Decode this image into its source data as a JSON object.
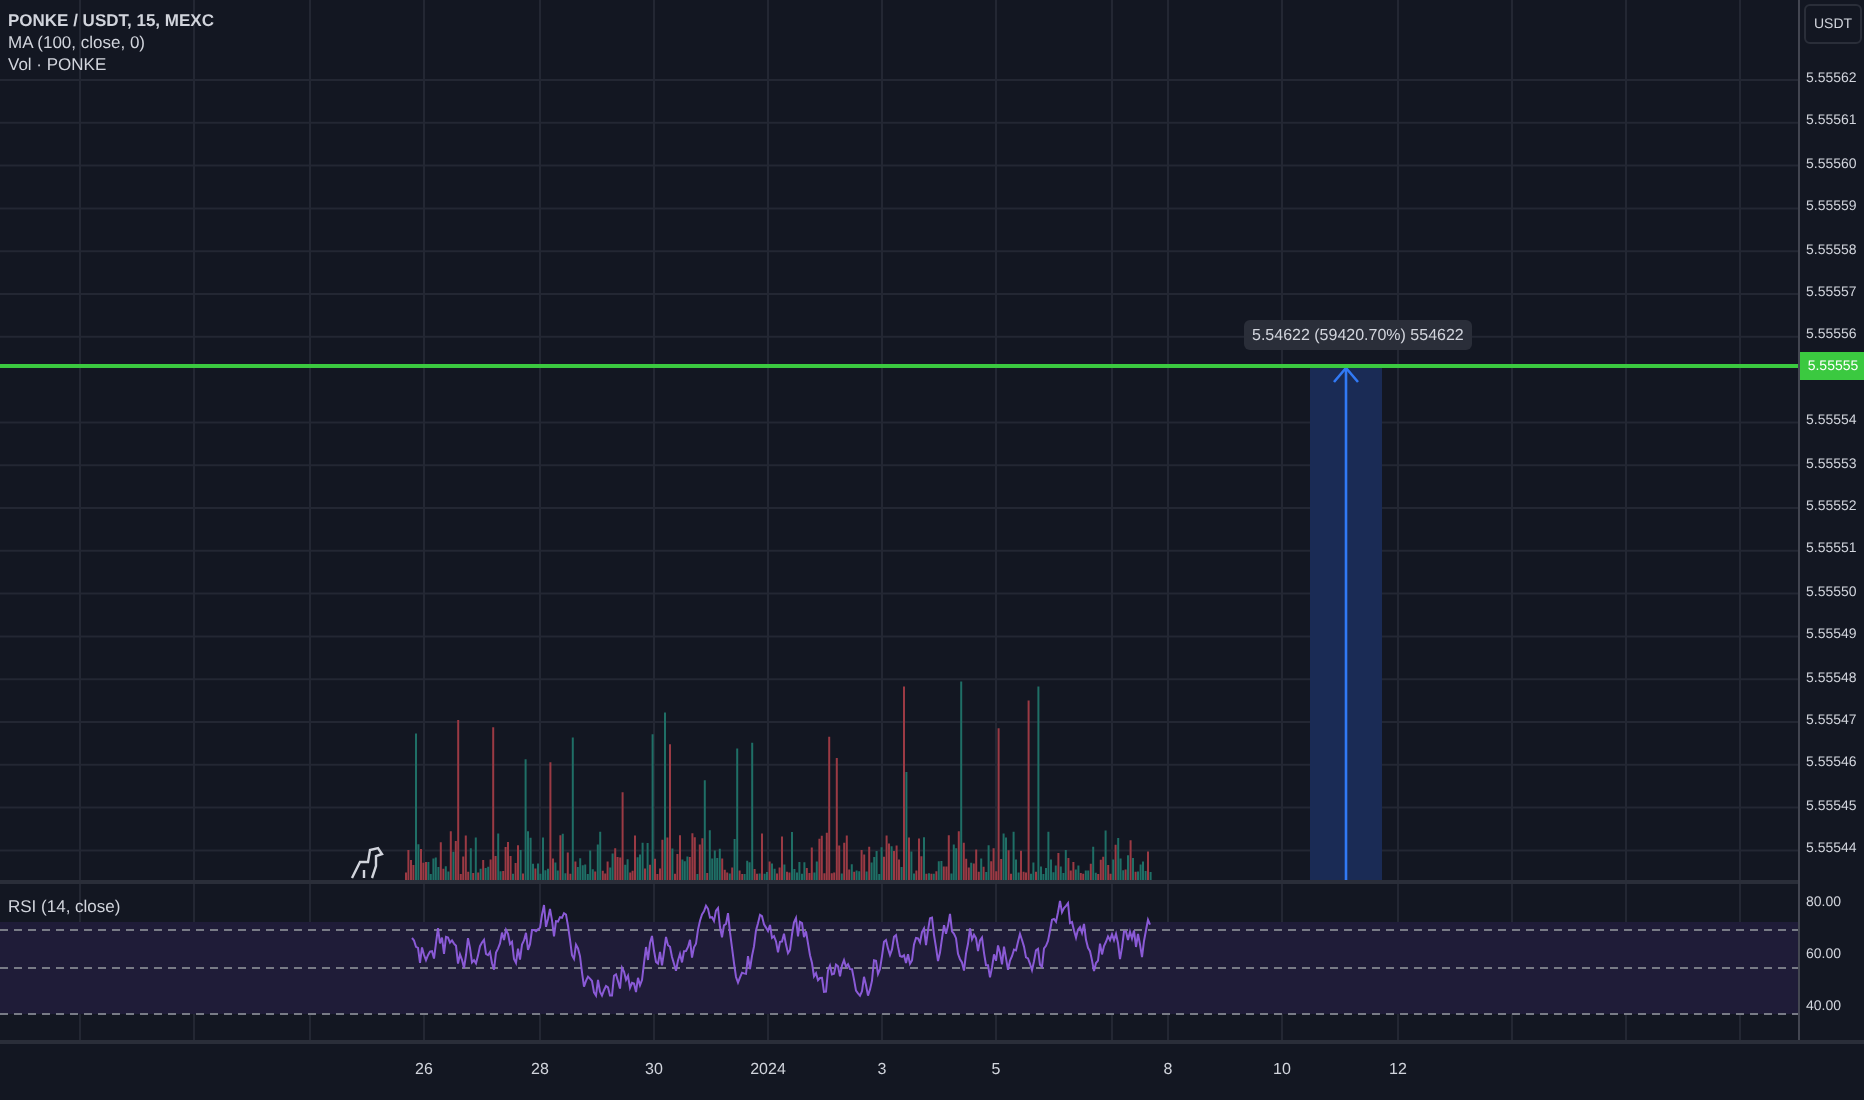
{
  "legend": {
    "symbol": "PONKE / USDT, 15, MEXC",
    "indicators": [
      "MA (100, close, 0)",
      "Vol · PONKE"
    ]
  },
  "price_axis": {
    "currency": "USDT",
    "ticks": [
      "5.55562",
      "5.55561",
      "5.55560",
      "5.55559",
      "5.55558",
      "5.55557",
      "5.55556",
      "5.55554",
      "5.55553",
      "5.55552",
      "5.55551",
      "5.55550",
      "5.55549",
      "5.55548",
      "5.55547",
      "5.55546",
      "5.55545",
      "5.55544"
    ],
    "current_price": "5.55555"
  },
  "measure": {
    "label": "5.54622 (59420.70%) 554622"
  },
  "rsi": {
    "title": "RSI (14, close)",
    "ticks": [
      "80.00",
      "60.00",
      "40.00"
    ]
  },
  "time_axis": {
    "labels": [
      "26",
      "28",
      "30",
      "2024",
      "3",
      "5",
      "8",
      "10",
      "12"
    ]
  }
}
